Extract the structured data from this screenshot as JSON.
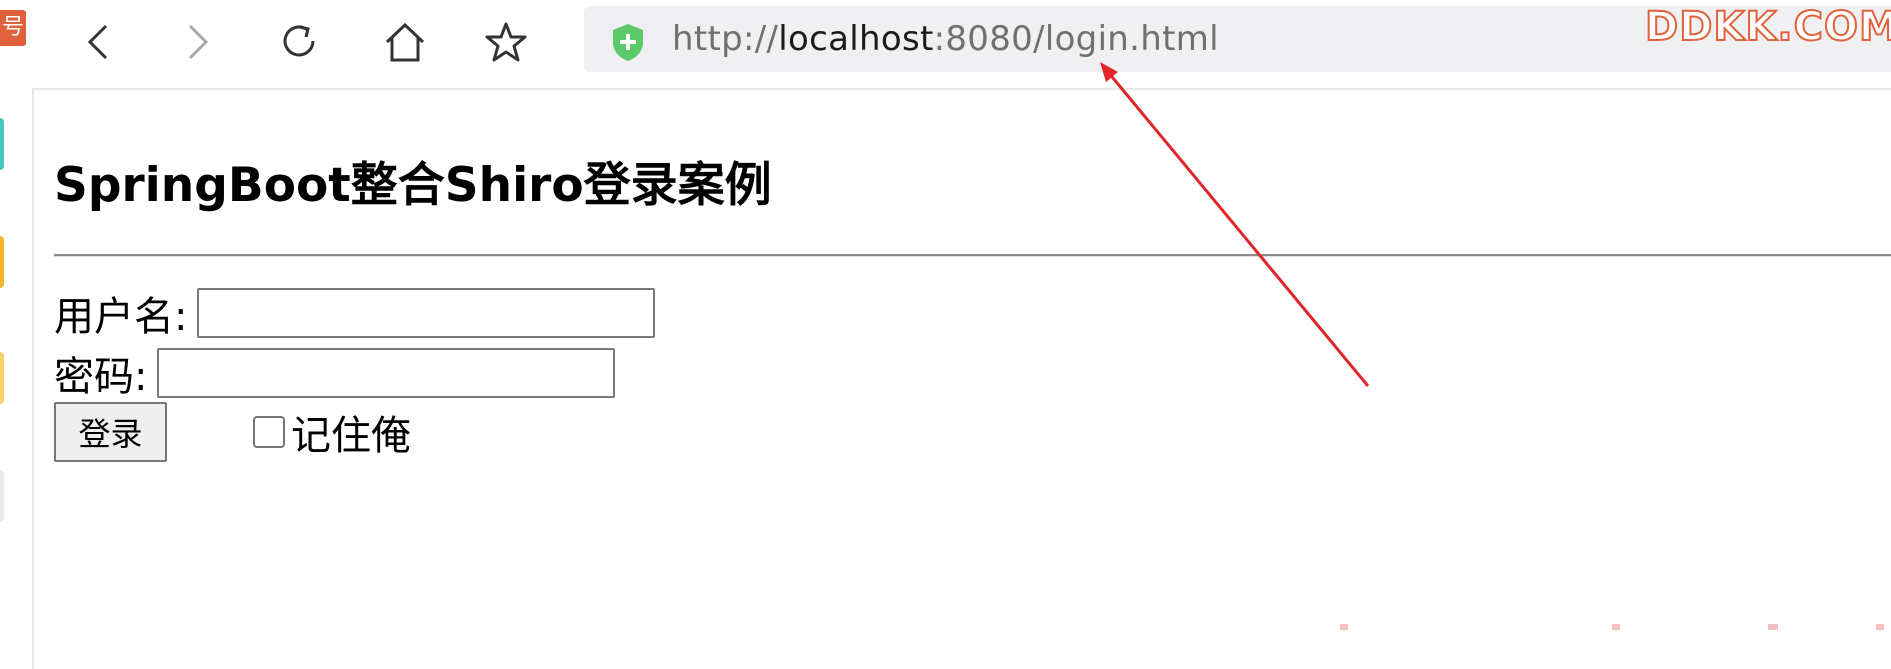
{
  "sidebar": {
    "badge_char": "号"
  },
  "browser": {
    "nav": {
      "back_icon": "chevron-left-icon",
      "forward_icon": "chevron-right-icon",
      "reload_icon": "reload-icon",
      "home_icon": "home-icon",
      "favorite_icon": "star-icon"
    },
    "address": {
      "security_icon": "shield-plus-icon",
      "scheme": "http://",
      "host": "localhost",
      "port": ":8080",
      "path": "/login.html"
    },
    "watermark": "DDKK.COM"
  },
  "page": {
    "title": "SpringBoot整合Shiro登录案例",
    "form": {
      "username_label": "用户名:",
      "username_value": "",
      "password_label": "密码:",
      "password_value": "",
      "submit_label": "登录",
      "remember_label": "记住俺",
      "remember_checked": false
    }
  },
  "colors": {
    "annotation_arrow": "#e0252b",
    "shield": "#5cc96b",
    "watermark": "#e0623c"
  }
}
